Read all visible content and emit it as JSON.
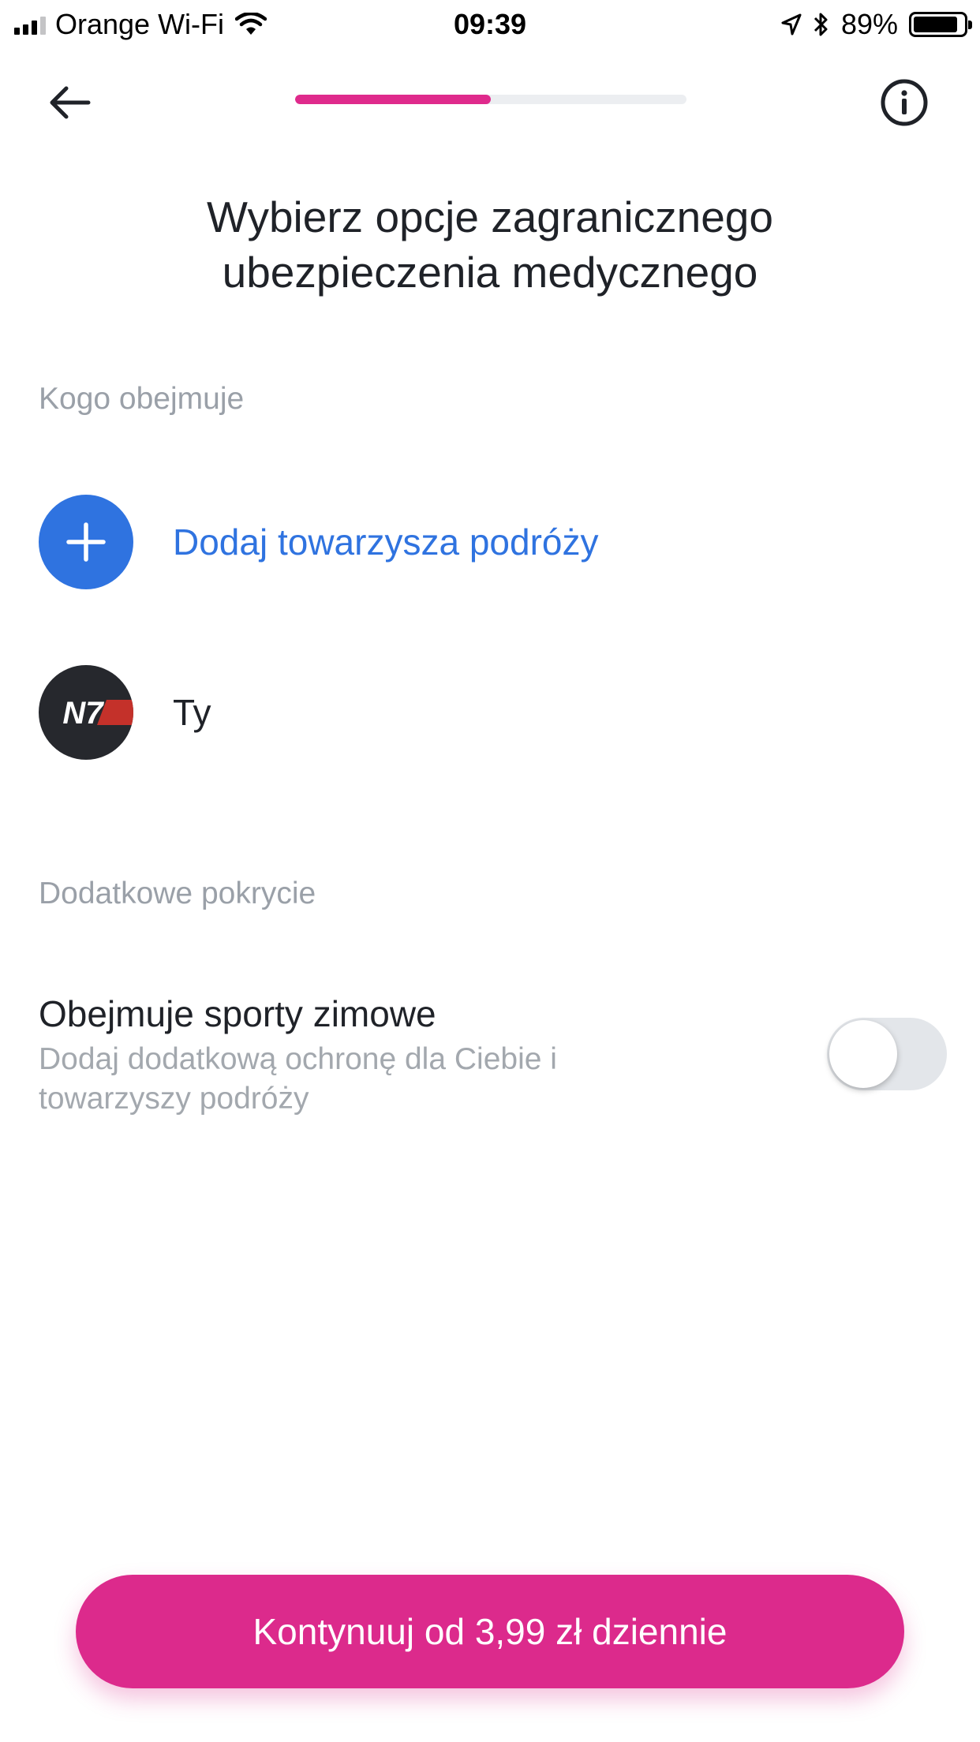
{
  "status_bar": {
    "carrier": "Orange Wi-Fi",
    "time": "09:39",
    "battery": "89%"
  },
  "nav": {
    "progress": 0.5,
    "back_icon": "arrow-left-icon",
    "info_icon": "info-circle-icon"
  },
  "title": {
    "line1": "Wybierz opcje zagranicznego",
    "line2": "ubezpieczenia medycznego"
  },
  "covered": {
    "section_label": "Kogo obejmuje",
    "add_companion": "Dodaj towarzysza podróży",
    "user_label": "Ty",
    "avatar_text": "N7"
  },
  "extra": {
    "section_label": "Dodatkowe pokrycie",
    "option_title": "Obejmuje sporty zimowe",
    "option_desc_line1": "Dodaj dodatkową ochronę dla Ciebie i",
    "option_desc_line2": "towarzyszy podróży",
    "toggle_on": false
  },
  "cta": {
    "label": "Kontynuuj od 3,99 zł dziennie"
  },
  "colors": {
    "accent_pink": "#dc2a8c",
    "accent_blue": "#2f73e0"
  }
}
